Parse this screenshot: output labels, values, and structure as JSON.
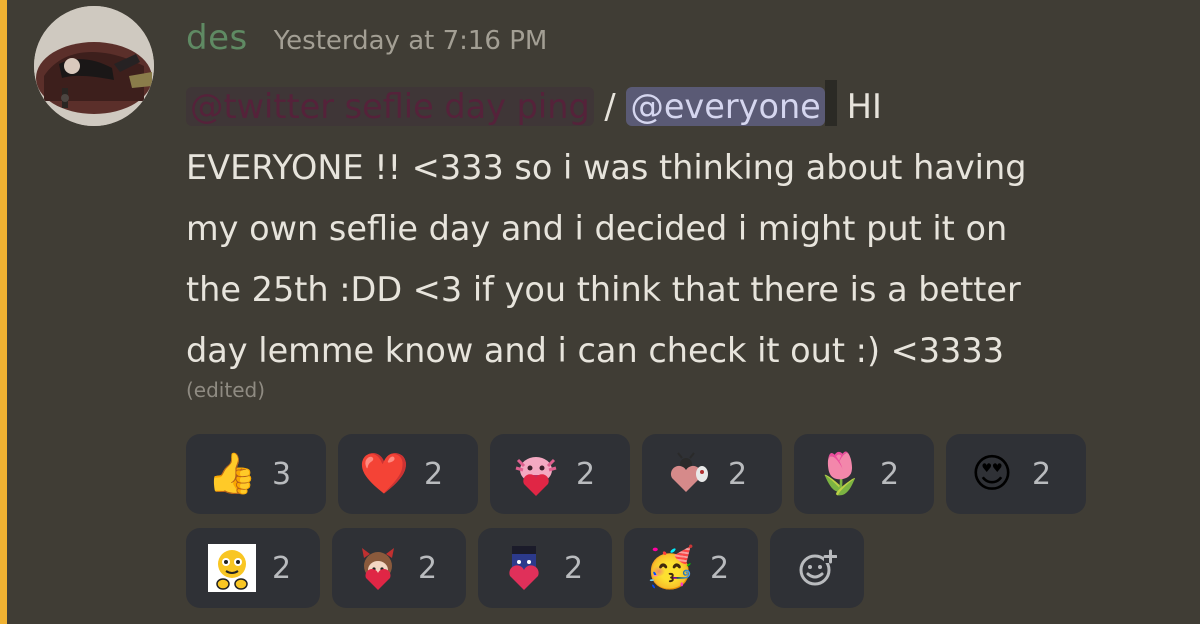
{
  "author": {
    "name": "des",
    "timestamp": "Yesterday at 7:16 PM"
  },
  "message": {
    "role_mention": "@twitter seflie day ping",
    "separator": " / ",
    "everyone_mention": "@everyone",
    "line1_tail": "HI",
    "lines": [
      "EVERYONE !! <333 so i was thinking about having",
      "my own seflie day and i decided i might put it on",
      "the 25th :DD <3 if you think that there is a better",
      "day lemme know and i can check it out :) <3333"
    ],
    "edited": "(edited)"
  },
  "reactions": {
    "row1": [
      {
        "emoji": "👍",
        "name": "thumbs-up",
        "count": "3"
      },
      {
        "emoji": "❤️",
        "name": "red-heart",
        "count": "2"
      },
      {
        "emoji": "",
        "name": "pink-axolotl-heart",
        "count": "2"
      },
      {
        "emoji": "",
        "name": "ladybug-heart",
        "count": "2"
      },
      {
        "emoji": "🌷",
        "name": "tulip",
        "count": "2"
      },
      {
        "emoji": "😍",
        "name": "heart-eyes",
        "count": "2"
      }
    ],
    "row2": [
      {
        "emoji": "",
        "name": "cursed-smiley-hands",
        "count": "2"
      },
      {
        "emoji": "",
        "name": "devil-girl-heart",
        "count": "2"
      },
      {
        "emoji": "",
        "name": "blue-creature-heart",
        "count": "2"
      },
      {
        "emoji": "🥳",
        "name": "partying-face",
        "count": "2"
      }
    ]
  },
  "colors": {
    "background": "#403d35",
    "highlight_bar": "#f0b232",
    "username": "#5f8a63",
    "reaction_bg": "#2f3136"
  }
}
